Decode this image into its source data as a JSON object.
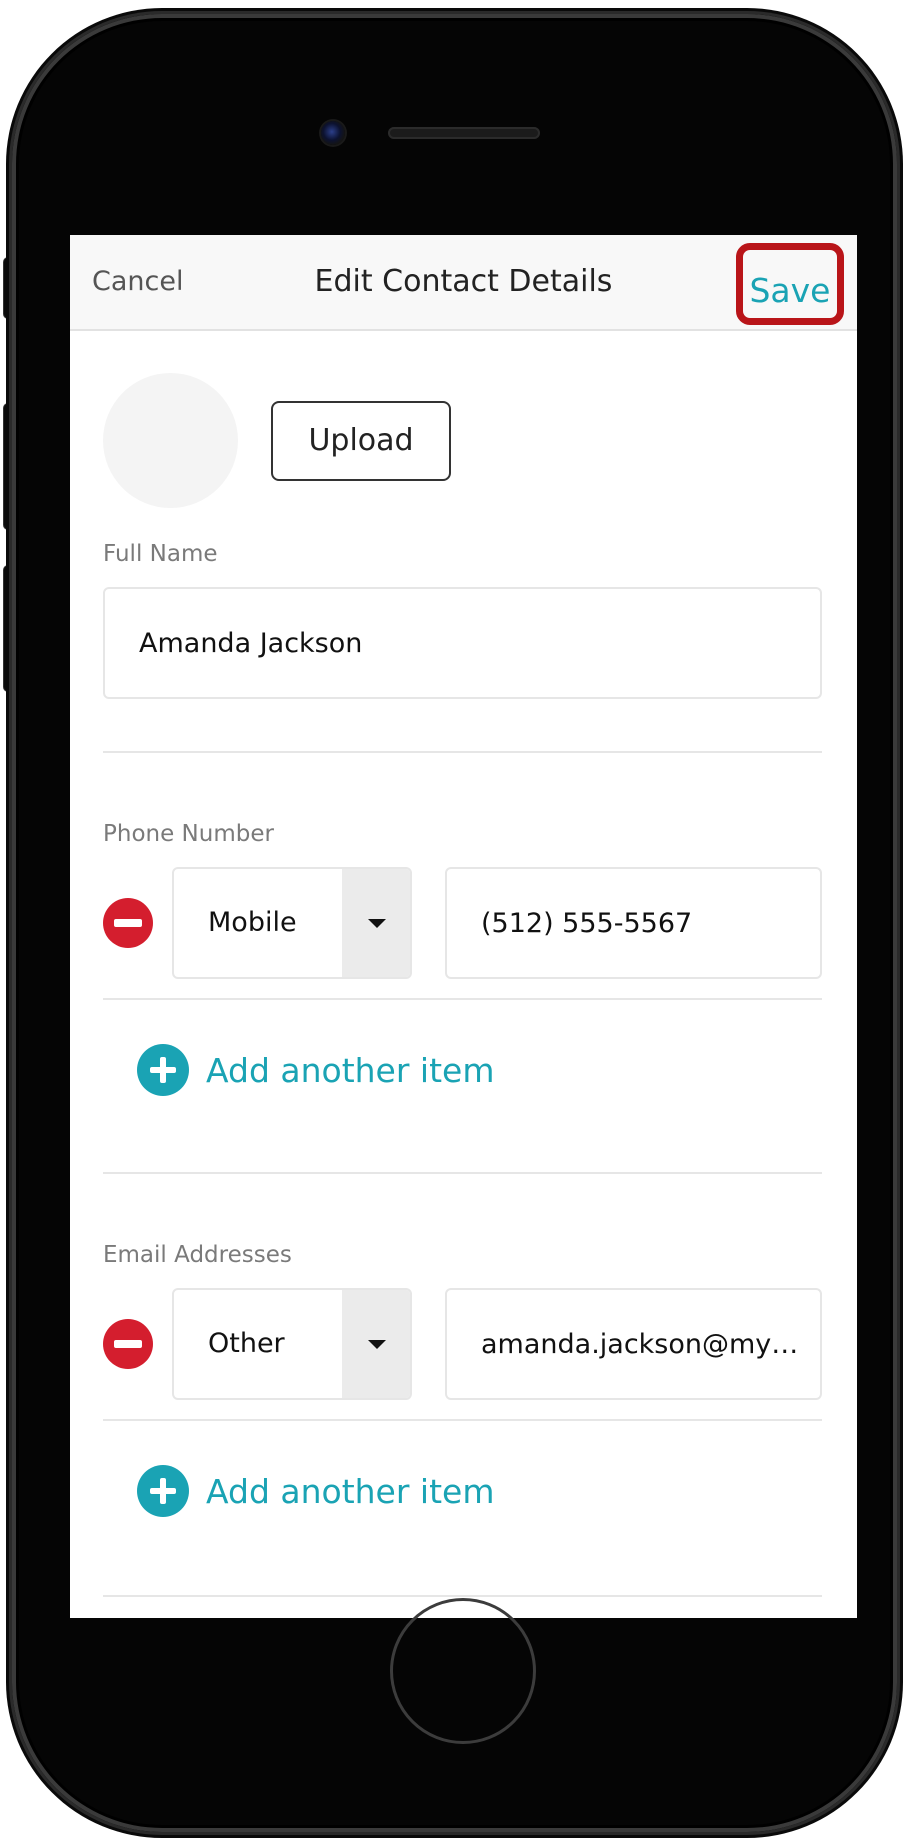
{
  "nav": {
    "cancel_label": "Cancel",
    "title": "Edit Contact Details",
    "save_label": "Save"
  },
  "profile": {
    "upload_label": "Upload"
  },
  "full_name": {
    "label": "Full Name",
    "value": "Amanda Jackson"
  },
  "phone": {
    "label": "Phone Number",
    "type": "Mobile",
    "value": "(512) 555-5567",
    "add_label": "Add another item"
  },
  "email": {
    "label": "Email Addresses",
    "type": "Other",
    "value": "amanda.jackson@my…",
    "add_label": "Add another item"
  },
  "colors": {
    "accent": "#1aa3b4",
    "remove": "#d41e2e",
    "highlight": "#b91519"
  }
}
